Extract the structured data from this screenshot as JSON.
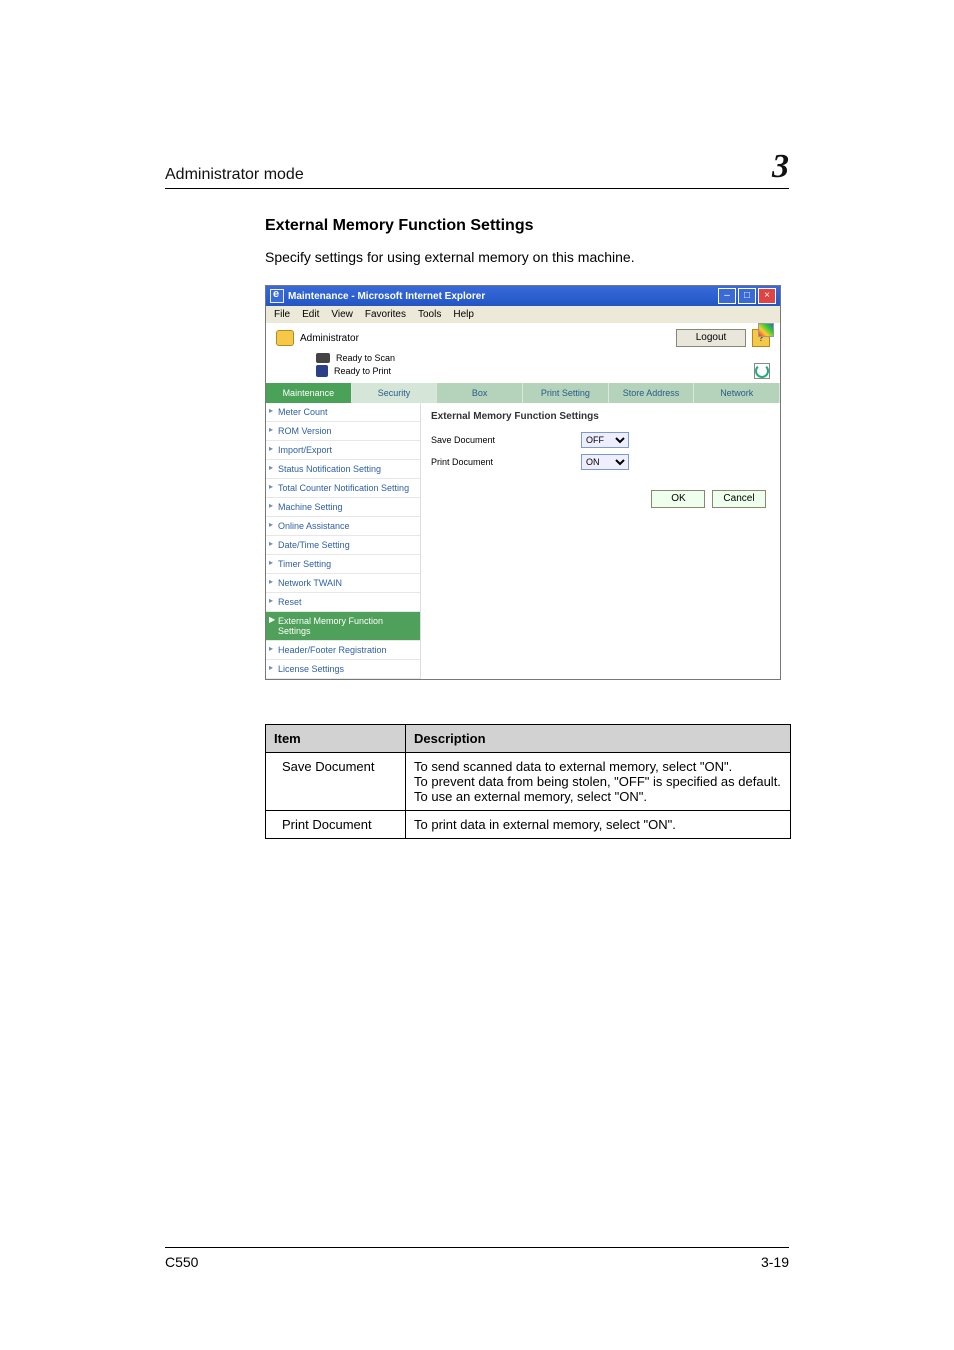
{
  "running_head": {
    "title": "Administrator mode",
    "chapter": "3"
  },
  "section_heading": "External Memory Function Settings",
  "section_body": "Specify settings for using external memory on this machine.",
  "browser": {
    "title": "Maintenance - Microsoft Internet Explorer",
    "menus": [
      "File",
      "Edit",
      "View",
      "Favorites",
      "Tools",
      "Help"
    ],
    "role": "Administrator",
    "logout": "Logout",
    "help": "?",
    "status_scan": "Ready to Scan",
    "status_print": "Ready to Print",
    "tabs": [
      "Maintenance",
      "Security",
      "Box",
      "Print Setting",
      "Store Address",
      "Network"
    ],
    "active_tab": 0,
    "sidebar": [
      "Meter Count",
      "ROM Version",
      "Import/Export",
      "Status Notification Setting",
      "Total Counter Notification Setting",
      "Machine Setting",
      "Online Assistance",
      "Date/Time Setting",
      "Timer Setting",
      "Network TWAIN",
      "Reset",
      "External Memory Function Settings",
      "Header/Footer Registration",
      "License Settings"
    ],
    "active_sidebar": 11,
    "panel_title": "External Memory Function Settings",
    "form": {
      "save_doc_label": "Save Document",
      "save_doc_value": "OFF",
      "print_doc_label": "Print Document",
      "print_doc_value": "ON"
    },
    "ok": "OK",
    "cancel": "Cancel"
  },
  "table": {
    "head": {
      "item": "Item",
      "desc": "Description"
    },
    "rows": [
      {
        "item": "Save Document",
        "desc": "To send scanned data to external memory, select \"ON\".\nTo prevent data from being stolen, \"OFF\" is specified as default. To use an external memory, select \"ON\"."
      },
      {
        "item": "Print Document",
        "desc": "To print data in external memory, select \"ON\"."
      }
    ]
  },
  "footer": {
    "left": "C550",
    "right": "3-19"
  }
}
